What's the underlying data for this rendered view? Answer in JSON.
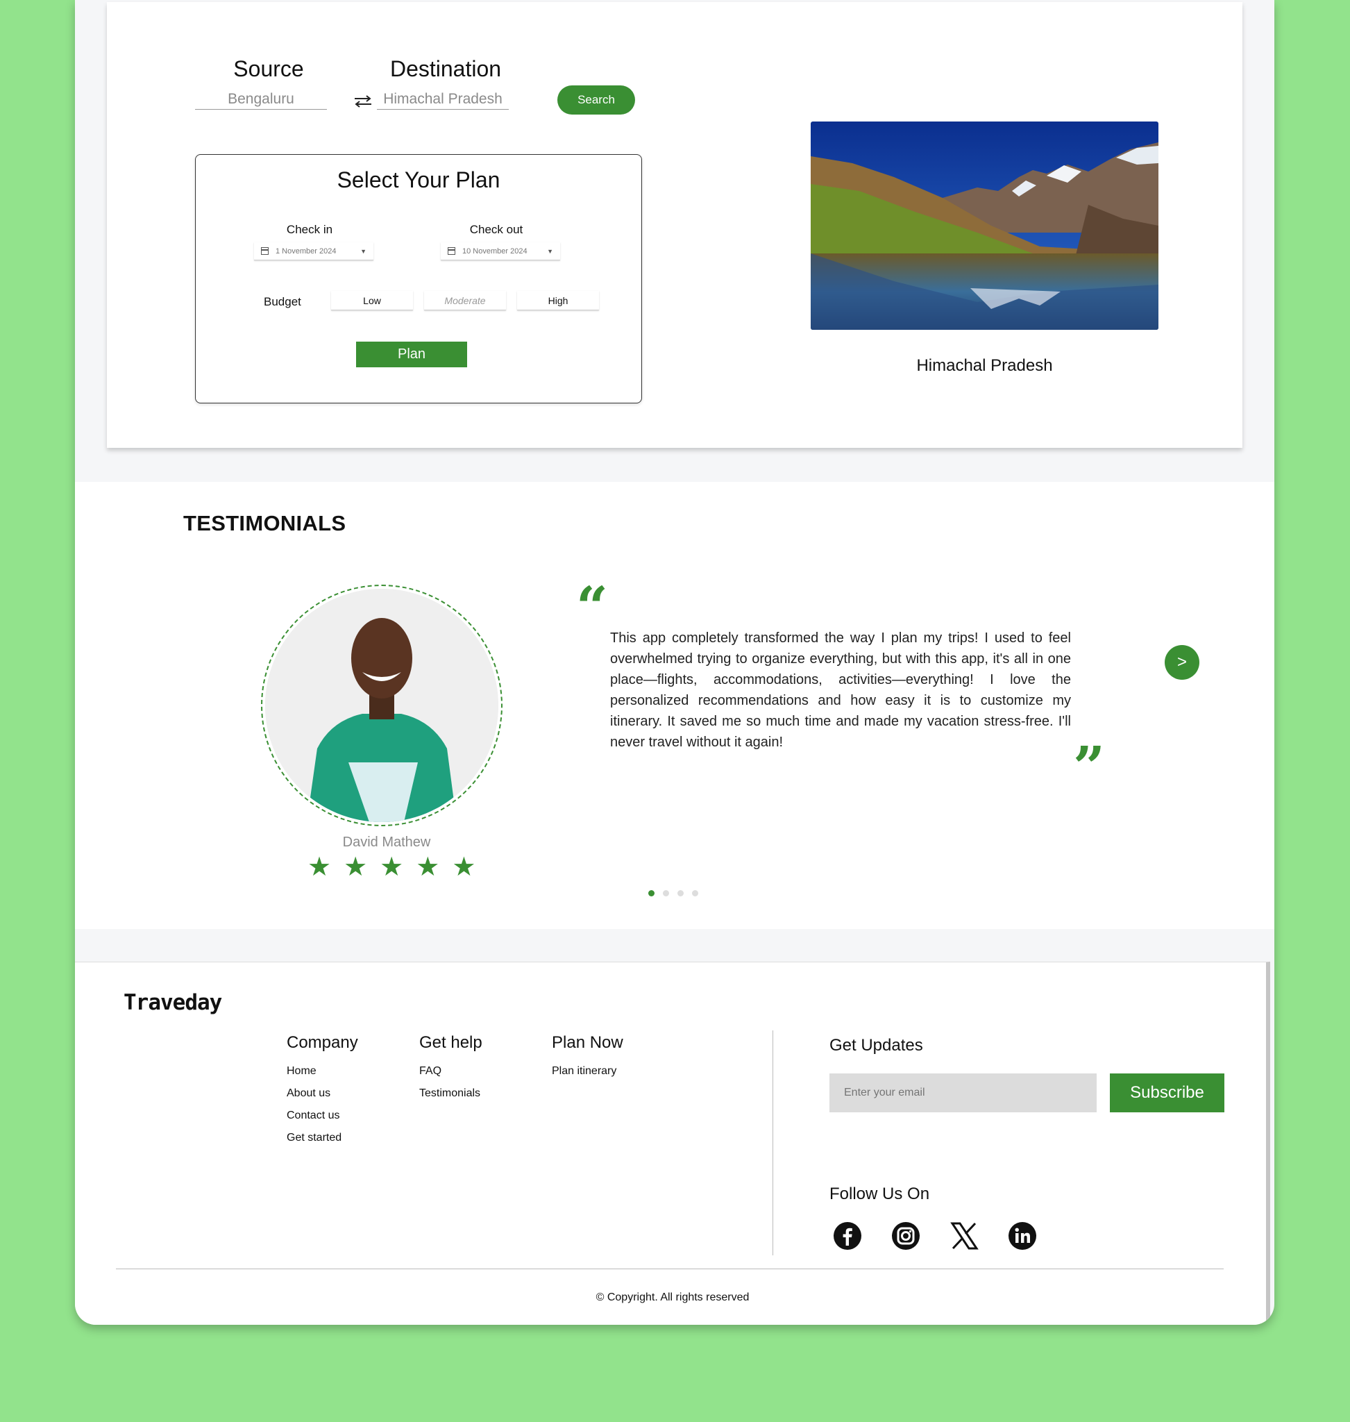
{
  "search": {
    "source_label": "Source",
    "source_value": "Bengaluru",
    "destination_label": "Destination",
    "destination_value": "Himachal Pradesh",
    "button_label": "Search"
  },
  "plan": {
    "title": "Select Your Plan",
    "check_in_label": "Check in",
    "check_in_value": "1 November 2024",
    "check_out_label": "Check out",
    "check_out_value": "10 November 2024",
    "budget_label": "Budget",
    "budget_options": [
      "Low",
      "Moderate",
      "High"
    ],
    "plan_button": "Plan"
  },
  "destination": {
    "caption": "Himachal Pradesh"
  },
  "testimonials": {
    "title": "TESTIMONIALS",
    "reviewer_name": "David Mathew",
    "rating": 5,
    "rating_max": 5,
    "text": "This app completely transformed the way I plan my trips! I used to feel overwhelmed trying to organize everything, but with this app, it's all in one place—flights, accommodations, activities—everything! I love the personalized recommendations and how easy it is to customize my itinerary. It saved me so much time and made my vacation stress-free. I'll never travel without it again!",
    "open_quote": "“",
    "close_quote": "”",
    "next_symbol": ">",
    "slide_count": 4,
    "active_slide": 1
  },
  "footer": {
    "brand": "Traveday",
    "company": {
      "title": "Company",
      "links": [
        "Home",
        "About us",
        "Contact us",
        "Get started"
      ]
    },
    "help": {
      "title": "Get help",
      "links": [
        "FAQ",
        "Testimonials"
      ]
    },
    "plan_now": {
      "title": "Plan Now",
      "links": [
        "Plan itinerary"
      ]
    },
    "updates_title": "Get Updates",
    "email_placeholder": "Enter your email",
    "subscribe_label": "Subscribe",
    "follow_title": "Follow Us On",
    "social_icons": [
      "facebook-icon",
      "instagram-icon",
      "x-icon",
      "linkedin-icon"
    ],
    "copyright": "© Copyright. All rights reserved"
  },
  "colors": {
    "accent": "#3a8f33",
    "page_background": "#92e38c"
  }
}
